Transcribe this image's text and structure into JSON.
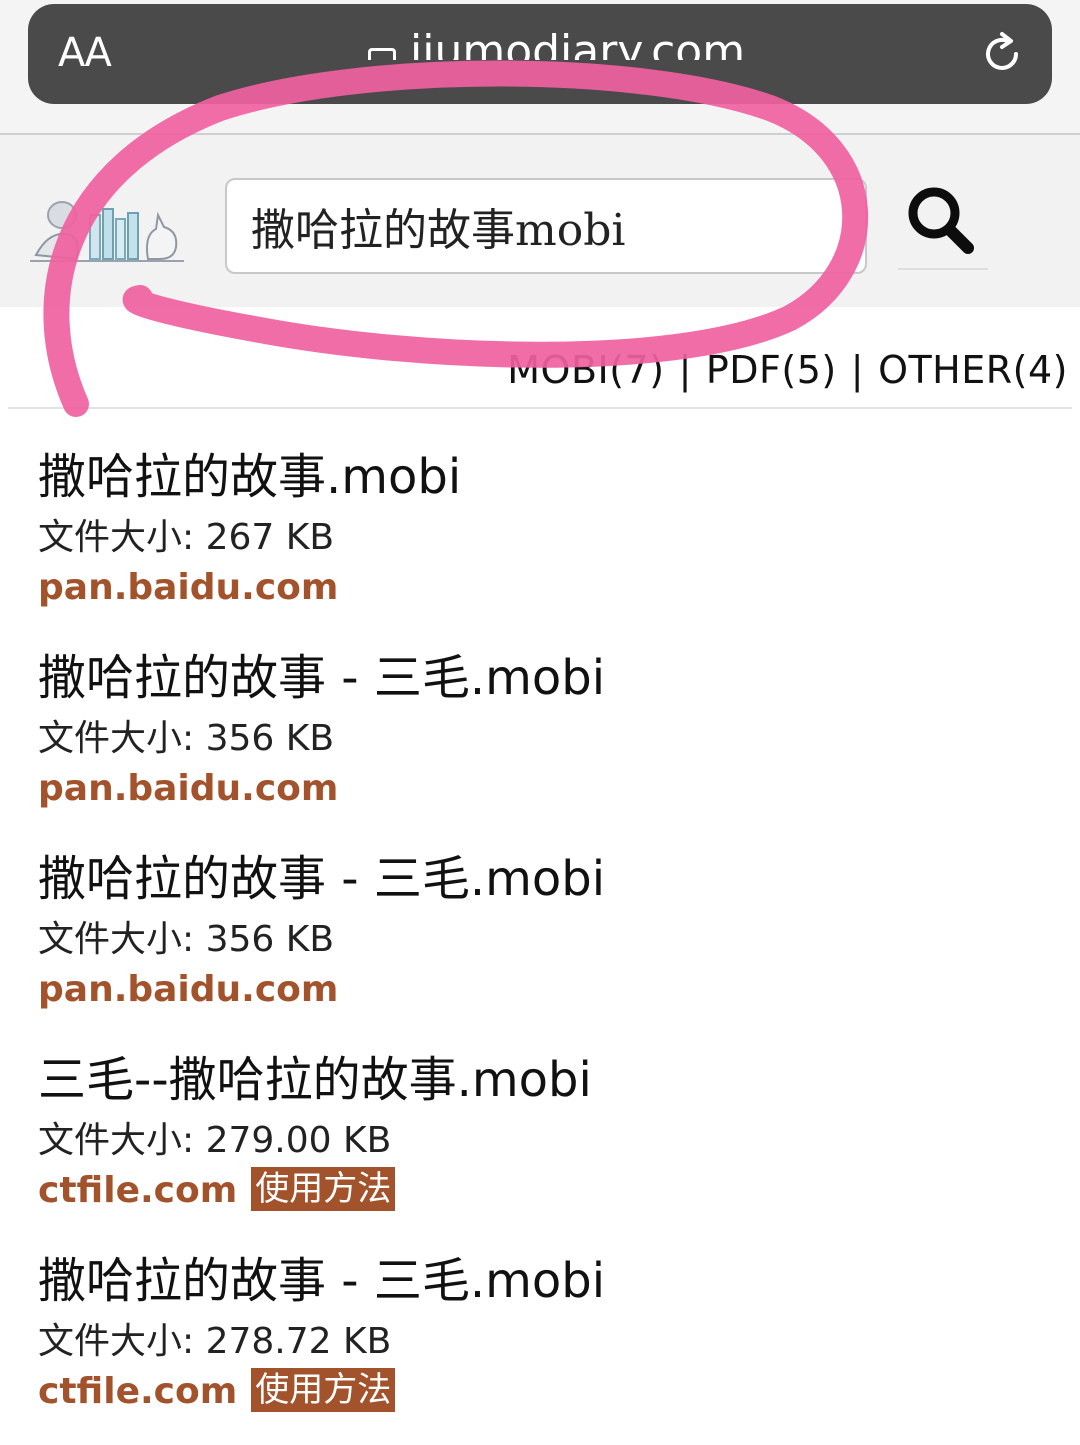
{
  "browser": {
    "text_size_label": "AA",
    "url": "jiumodiary.com",
    "reload_icon": "reload-icon",
    "lock_icon": "lock-icon"
  },
  "site": {
    "logo_icon": "bookshelf-logo-icon",
    "search_value": "撒哈拉的故事mobi",
    "search_icon": "search-icon"
  },
  "filters": [
    {
      "label": "MOBI(7)"
    },
    {
      "label": "PDF(5)"
    },
    {
      "label": "OTHER(4)"
    }
  ],
  "results": [
    {
      "title": "撒哈拉的故事.mobi",
      "size": "文件大小: 267 KB",
      "source": "pan.baidu.com",
      "howto": ""
    },
    {
      "title": "撒哈拉的故事 - 三毛.mobi",
      "size": "文件大小: 356 KB",
      "source": "pan.baidu.com",
      "howto": ""
    },
    {
      "title": "撒哈拉的故事 - 三毛.mobi",
      "size": "文件大小: 356 KB",
      "source": "pan.baidu.com",
      "howto": ""
    },
    {
      "title": "三毛--撒哈拉的故事.mobi",
      "size": "文件大小: 279.00 KB",
      "source": "ctfile.com",
      "howto": "使用方法"
    },
    {
      "title": "撒哈拉的故事 - 三毛.mobi",
      "size": "文件大小: 278.72 KB",
      "source": "ctfile.com",
      "howto": "使用方法"
    }
  ],
  "colors": {
    "accent_brown": "#a3532c",
    "annotation_pink": "#f0619f",
    "url_bar": "#4a4a4a"
  }
}
